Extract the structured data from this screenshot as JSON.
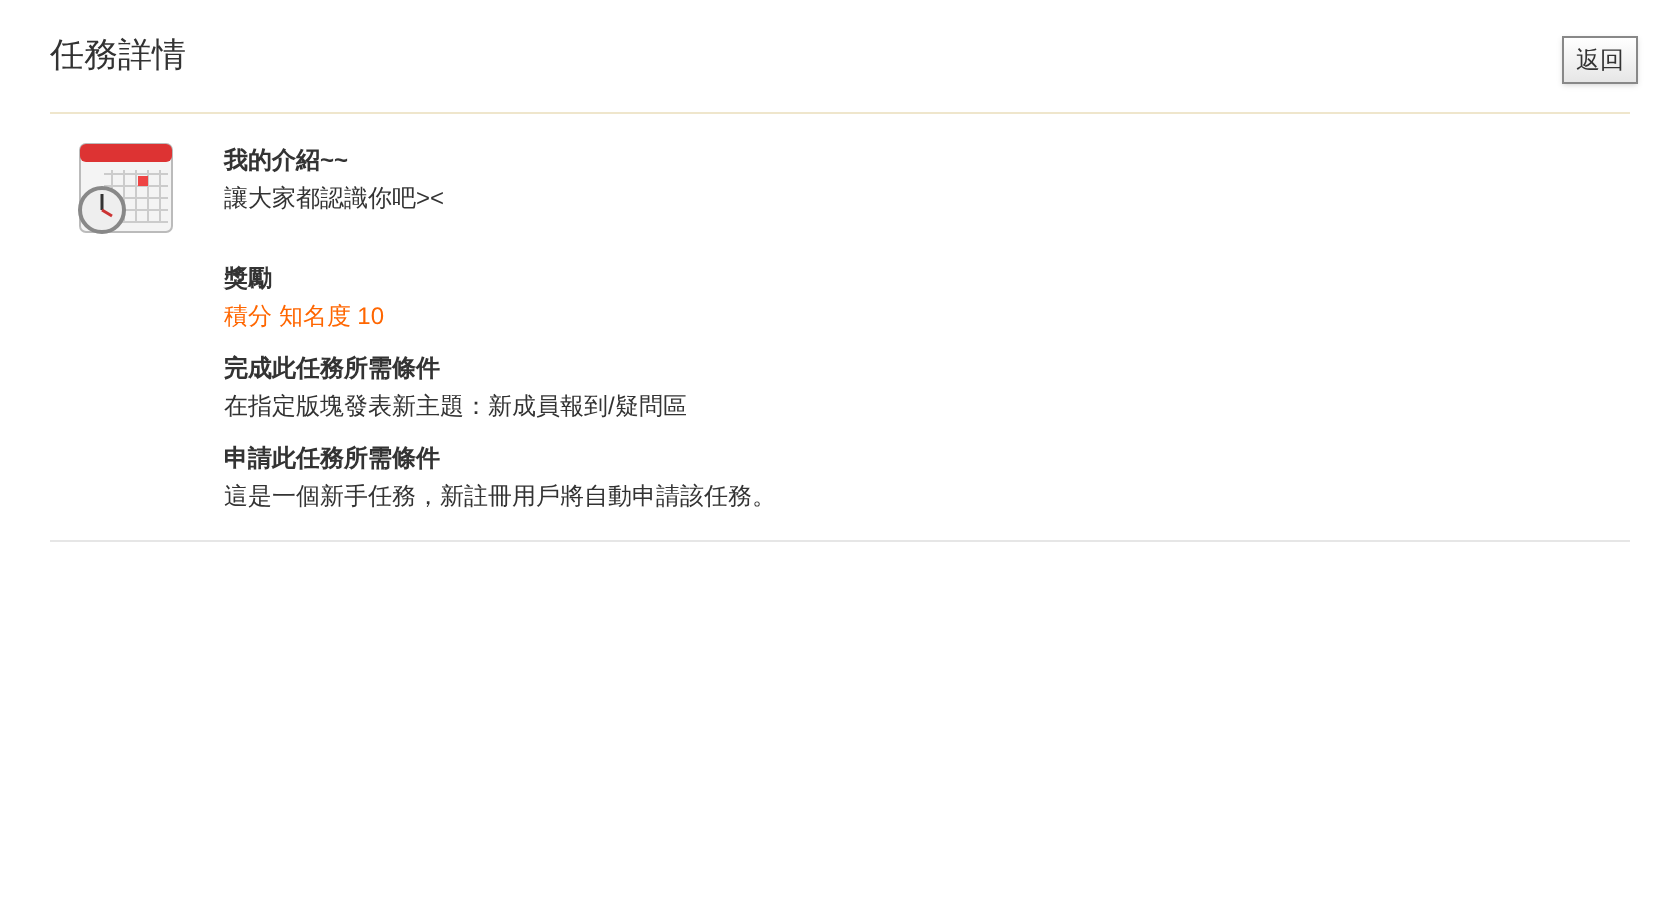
{
  "header": {
    "title": "任務詳情",
    "back_button": "返回"
  },
  "task": {
    "name": "我的介紹~~",
    "description": "讓大家都認識你吧><",
    "sections": [
      {
        "kind": "reward",
        "heading": "獎勵",
        "text": "積分 知名度 10"
      },
      {
        "kind": "plain",
        "heading": "完成此任務所需條件",
        "text": "在指定版塊發表新主題：新成員報到/疑問區"
      },
      {
        "kind": "plain",
        "heading": "申請此任務所需條件",
        "text": "這是一個新手任務，新註冊用戶將自動申請該任務。"
      }
    ]
  }
}
